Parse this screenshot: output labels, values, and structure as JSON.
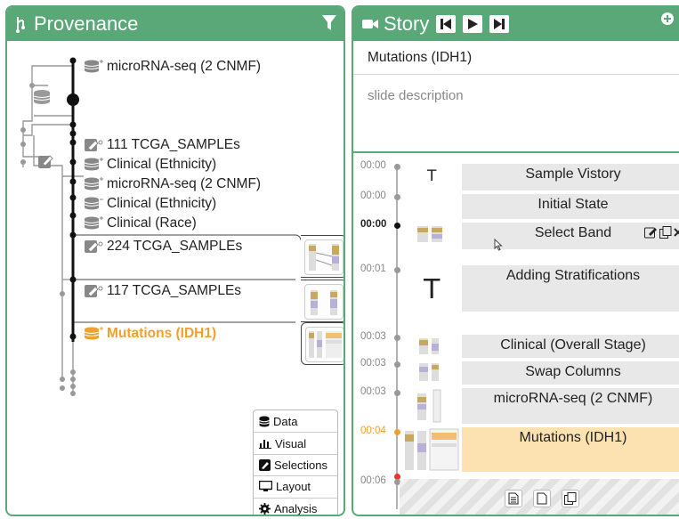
{
  "provenance": {
    "title": "Provenance",
    "nodes": [
      "microRNA-seq (2 CNMF)",
      "111 TCGA_SAMPLEs",
      "Clinical (Ethnicity)",
      "microRNA-seq (2 CNMF)",
      "Clinical (Ethnicity)",
      "Clinical (Race)",
      "224 TCGA_SAMPLEs",
      "117 TCGA_SAMPLEs",
      "Mutations (IDH1)"
    ],
    "view_buttons": [
      "Data",
      "Visual",
      "Selections",
      "Layout",
      "Analysis"
    ]
  },
  "story": {
    "title": "Story",
    "slide_title": "Mutations (IDH1)",
    "slide_description": "slide description",
    "timeline": [
      {
        "time": "00:00",
        "label": "Sample Vistory"
      },
      {
        "time": "00:00",
        "label": "Initial State"
      },
      {
        "time": "00:00",
        "label": "Select Band"
      },
      {
        "time": "00:01",
        "label": "Adding Stratifications"
      },
      {
        "time": "00:03",
        "label": "Clinical (Overall Stage)"
      },
      {
        "time": "00:03",
        "label": "Swap Columns"
      },
      {
        "time": "00:03",
        "label": "microRNA-seq (2 CNMF)"
      },
      {
        "time": "00:04",
        "label": "Mutations (IDH1)"
      },
      {
        "time": "00:06",
        "label": ""
      }
    ]
  },
  "colors": {
    "header_green": "#5aa777",
    "active_orange": "#f0a030",
    "active_slide": "#fce2b0",
    "slide_gray": "#e8e8e8"
  }
}
